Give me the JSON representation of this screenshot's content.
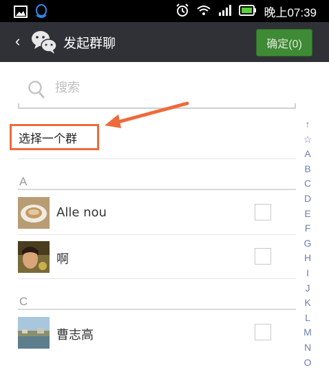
{
  "status_bar": {
    "time": "晚上07:39",
    "icons": [
      "image-icon",
      "qq-icon",
      "alarm-icon",
      "wifi-icon",
      "signal-icon",
      "battery-icon"
    ]
  },
  "header": {
    "back_glyph": "‹",
    "title": "发起群聊",
    "confirm_label": "确定(0)",
    "accent_color": "#3f8a35",
    "background_color": "#2f3136"
  },
  "search": {
    "placeholder": "搜索"
  },
  "select_group": {
    "label": "选择一个群",
    "highlight_color": "#ef6a3a"
  },
  "sections": [
    {
      "letter": "A",
      "contacts": [
        {
          "name": "Alle    nou"
        },
        {
          "name": "啊"
        }
      ]
    },
    {
      "letter": "C",
      "contacts": [
        {
          "name": "曹志高"
        }
      ]
    }
  ],
  "index": [
    "↑",
    "☆",
    "A",
    "B",
    "C",
    "D",
    "E",
    "F",
    "G",
    "H",
    "I",
    "J",
    "K",
    "L",
    "M",
    "N",
    "O"
  ]
}
